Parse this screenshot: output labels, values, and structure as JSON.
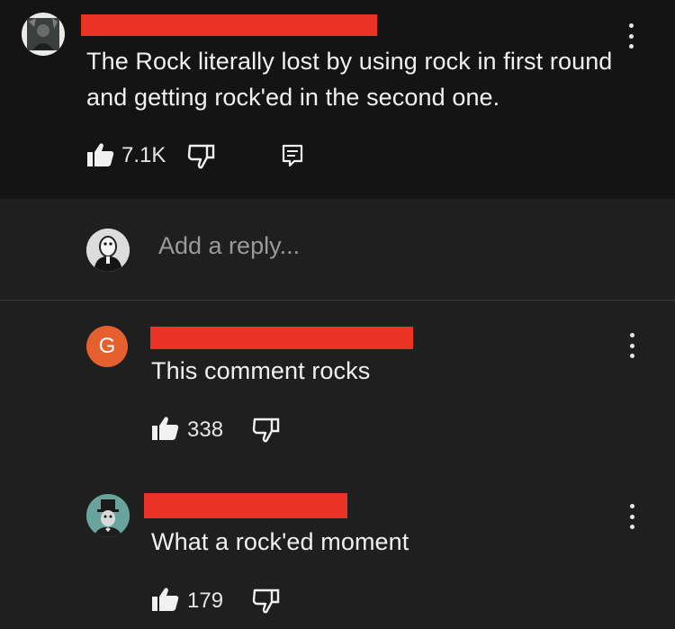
{
  "colors": {
    "top_background": "#141414",
    "background": "#1f1f1f",
    "redaction": "#ea3324",
    "avatar_orange": "#e4602f"
  },
  "main_comment": {
    "text": "The Rock literally lost by using rock in first round and getting rock'ed in the second one.",
    "likes": "7.1K",
    "avatar_icon": "user-photo-avatar"
  },
  "reply_box": {
    "placeholder": "Add a reply...",
    "avatar_icon": "penguin-avatar"
  },
  "replies": [
    {
      "avatar_letter": "G",
      "text": "This comment rocks",
      "likes": "338"
    },
    {
      "avatar_icon": "top-hat-man-avatar",
      "text": "What a rock'ed moment",
      "likes": "179"
    }
  ]
}
